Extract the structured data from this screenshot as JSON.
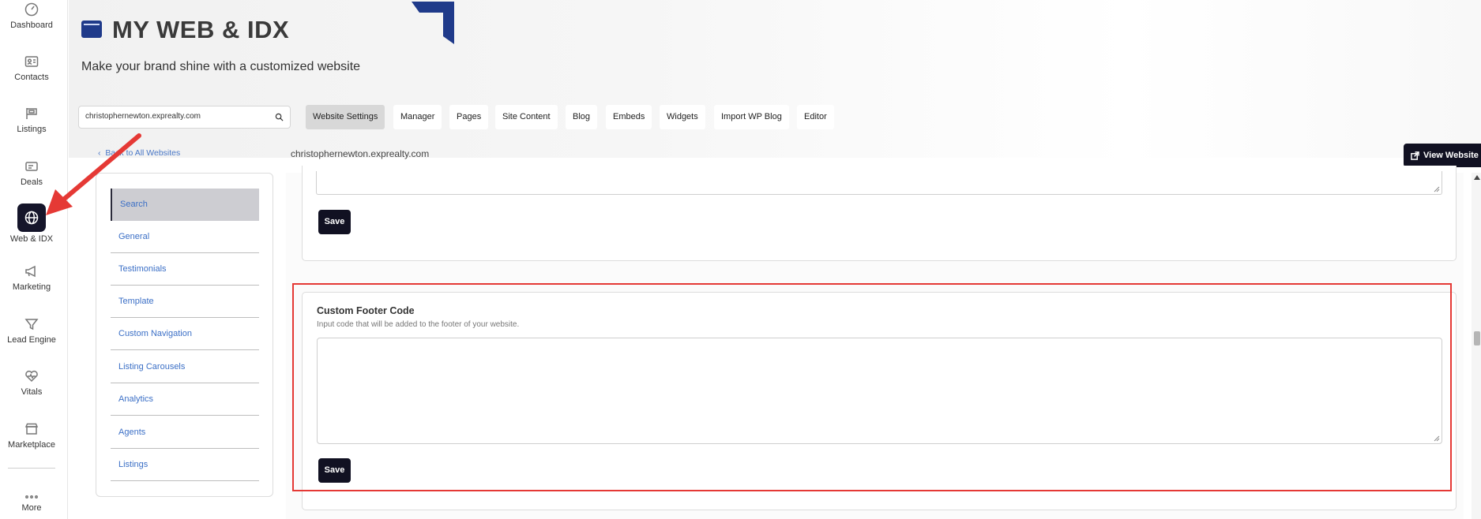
{
  "nav": {
    "items": [
      {
        "label": "Dashboard",
        "icon": "dashboard-icon"
      },
      {
        "label": "Contacts",
        "icon": "contacts-icon"
      },
      {
        "label": "Listings",
        "icon": "listings-icon"
      },
      {
        "label": "Deals",
        "icon": "deals-icon"
      },
      {
        "label": "Web & IDX",
        "icon": "globe-icon"
      },
      {
        "label": "Marketing",
        "icon": "megaphone-icon"
      },
      {
        "label": "Lead Engine",
        "icon": "funnel-icon"
      },
      {
        "label": "Vitals",
        "icon": "heart-pulse-icon"
      },
      {
        "label": "Marketplace",
        "icon": "store-icon"
      },
      {
        "label": "More",
        "icon": "more-dots-icon"
      }
    ]
  },
  "header": {
    "title": "MY WEB & IDX",
    "subtitle": "Make your brand shine with a customized website"
  },
  "toolbar": {
    "site_value": "christophernewton.exprealty.com",
    "tabs": [
      "Website Settings",
      "Manager",
      "Pages",
      "Site Content",
      "Blog",
      "Embeds",
      "Widgets",
      "Import WP Blog",
      "Editor"
    ],
    "active_tab": "Website Settings"
  },
  "back_link": "Back to All Websites",
  "domain": "christophernewton.exprealty.com",
  "view_website": "View Website",
  "settings_menu": {
    "items": [
      "Search",
      "General",
      "Testimonials",
      "Template",
      "Custom Navigation",
      "Listing Carousels",
      "Analytics",
      "Agents",
      "Listings"
    ],
    "active": "Search"
  },
  "top_card": {
    "save_label": "Save"
  },
  "footer_card": {
    "title": "Custom Footer Code",
    "help": "Input code that will be added to the footer of your website.",
    "textarea_value": "",
    "save_label": "Save"
  },
  "colors": {
    "accent_dark": "#111122",
    "link": "#3b6fc6",
    "highlight": "#e53935",
    "brand_blue": "#1f3a8a"
  }
}
